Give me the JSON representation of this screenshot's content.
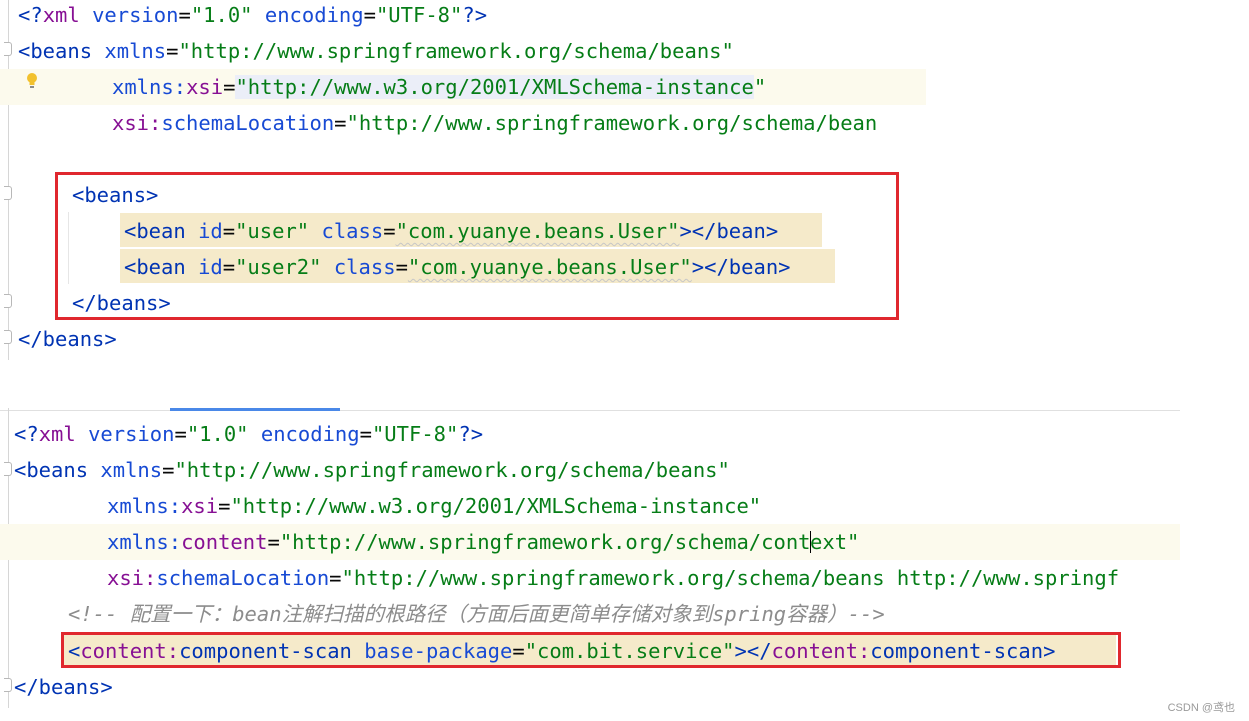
{
  "panel1": {
    "lines": [
      [
        "<?xml version=\"1.0\" encoding=\"UTF-8\"?>"
      ],
      [
        "<beans xmlns=\"http://www.springframework.org/schema/beans\""
      ],
      [
        "xmlns:xsi=\"http://www.w3.org/2001/XMLSchema-instance\""
      ],
      [
        "xsi:schemaLocation=\"http://www.springframework.org/schema/bean"
      ],
      [
        ""
      ],
      [
        "<beans>"
      ],
      [
        "<bean id=\"user\" class=\"com.yuanye.beans.User\"></bean>"
      ],
      [
        "<bean id=\"user2\" class=\"com.yuanye.beans.User\"></bean>"
      ],
      [
        "</beans>"
      ],
      [
        "</beans>"
      ]
    ]
  },
  "panel2": {
    "lines": [
      [
        "<?xml version=\"1.0\" encoding=\"UTF-8\"?>"
      ],
      [
        "<beans xmlns=\"http://www.springframework.org/schema/beans\""
      ],
      [
        "xmlns:xsi=\"http://www.w3.org/2001/XMLSchema-instance\""
      ],
      [
        "xmlns:content=\"http://www.springframework.org/schema/context\""
      ],
      [
        "xsi:schemaLocation=\"http://www.springframework.org/schema/beans http://www.springf"
      ],
      [
        "<!-- 配置一下：bean注解扫描的根路径（方面后面更简单存储对象到spring容器）-->"
      ],
      [
        "<content:component-scan base-package=\"com.bit.service\"></content:component-scan>"
      ],
      [
        "</beans>"
      ]
    ]
  },
  "tokens": {
    "xml_open": "<?",
    "xml_kw": "xml",
    "version_attr": "version",
    "version_val": "\"1.0\"",
    "encoding_attr": "encoding",
    "encoding_val": "\"UTF-8\"",
    "xml_close": "?>",
    "beans_open": "<beans",
    "xmlns_attr": "xmlns",
    "beans_ns_val": "\"http://www.springframework.org/schema/beans\"",
    "xmlns_prefix": "xmlns:",
    "xsi_local": "xsi",
    "xsi_val_open": "\"",
    "xsi_url": "http://www.w3.org/2001/XMLSchema-instance",
    "xsi_val_close": "\"",
    "xsi_val_full": "\"http://www.w3.org/2001/XMLSchema-instance\"",
    "xsi_prefix": "xsi:",
    "schemaLocation_local": "schemaLocation",
    "schema_val_1": "\"http://www.springframework.org/schema/bean",
    "schema_val_2": "\"http://www.springframework.org/schema/beans http://www.springf",
    "content_local": "content",
    "content_val_a": "\"http://www.springframework.org/schema/cont",
    "content_val_b": "ext\"",
    "beans_tag": "<beans>",
    "beans_close": "</beans>",
    "bean_open": "<bean",
    "id_attr": "id",
    "id_user": "\"user\"",
    "id_user2": "\"user2\"",
    "class_attr": "class",
    "class_val": "\"com.yuanye.beans.User\"",
    "bean_end": "></bean>",
    "eq": "=",
    "gt": ">",
    "lt": "<",
    "lt_slash": "</",
    "comment": "<!-- 配置一下：bean注解扫描的根路径（方面后面更简单存储对象到spring容器）-->",
    "cs_ns": "content:",
    "cs_name": "component-scan",
    "bp_attr": "base-package",
    "bp_val": "\"com.bit.service\""
  },
  "watermark": "CSDN @鸢也",
  "colors": {
    "tag": "#0033b3",
    "attribute": "#174ad4",
    "namespace": "#871094",
    "value": "#067d17",
    "comment": "#8c8c8c",
    "highlight_box": "#e0282e",
    "line_highlight": "#fcfaed",
    "bean_highlight": "#f5eaca"
  },
  "icons": [
    "lightbulb-icon",
    "fold-marker-icon"
  ]
}
